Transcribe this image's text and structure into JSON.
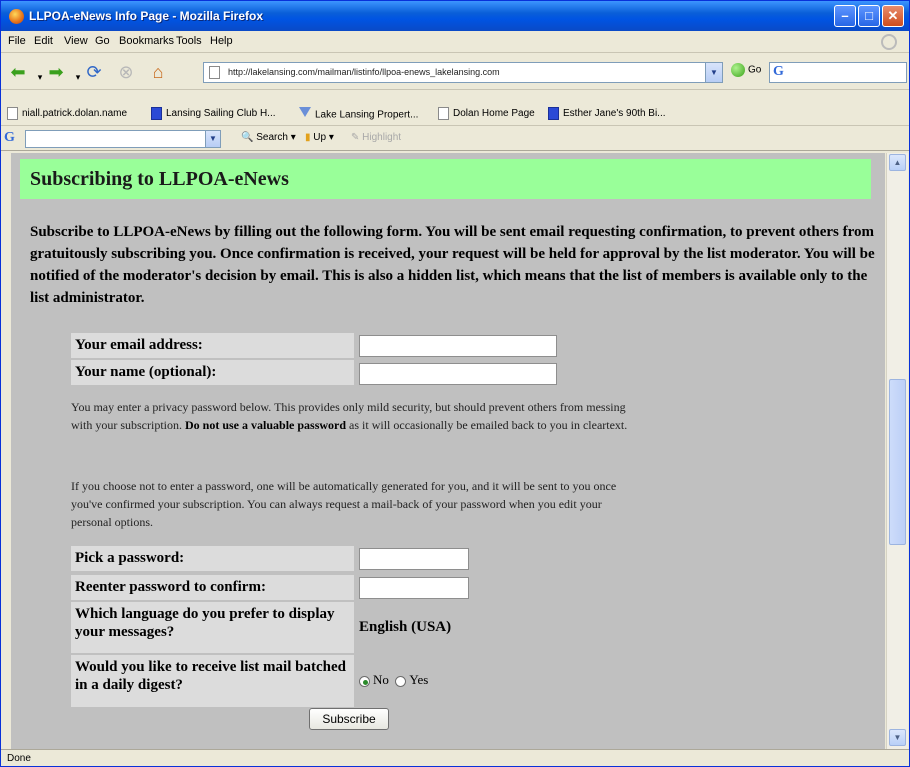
{
  "window": {
    "title": "LLPOA-eNews Info Page - Mozilla Firefox"
  },
  "menu": [
    "File",
    "Edit",
    "View",
    "Go",
    "Bookmarks",
    "Tools",
    "Help"
  ],
  "nav": {
    "url": "http://lakelansing.com/mailman/listinfo/llpoa-enews_lakelansing.com",
    "go_label": "Go",
    "search_logo": "G"
  },
  "bookmarks": [
    "niall.patrick.dolan.name",
    "Lansing Sailing Club H...",
    "Lake Lansing Propert...",
    "Dolan Home Page",
    "Esther Jane's 90th Bi..."
  ],
  "google_toolbar": {
    "logo": "G",
    "search_label": "Search",
    "up_label": "Up",
    "highlight_label": "Highlight"
  },
  "page": {
    "heading": "Subscribing to LLPOA-eNews",
    "intro": "Subscribe to LLPOA-eNews by filling out the following form. You will be sent email requesting confirmation, to prevent others from gratuitously subscribing you. Once confirmation is received, your request will be held for approval by the list moderator. You will be notified of the moderator's decision by email. This is also a hidden list, which means that the list of members is available only to the list administrator.",
    "email_label": "Your email address:",
    "email_value": "",
    "name_label": "Your name (optional):",
    "name_value": "",
    "note1_a": "You may enter a privacy password below. This provides only mild security, but should prevent others from messing with your subscription.",
    "note1_bold": "Do not use a valuable password",
    "note1_b": "as it will occasionally be emailed back to you in cleartext.",
    "note2": "If you choose not to enter a password, one will be automatically generated for you, and it will be sent to you once you've confirmed your subscription. You can always request a mail-back of your password when you edit your personal options.",
    "pw_label": "Pick a password:",
    "pw_confirm_label": "Reenter password to confirm:",
    "lang_label": "Which language do you prefer to display your messages?",
    "lang_value": "English (USA)",
    "digest_label": "Would you like to receive list mail batched in a daily digest?",
    "digest_no": "No",
    "digest_yes": "Yes",
    "digest_selected": "No",
    "subscribe_label": "Subscribe"
  },
  "status": "Done"
}
